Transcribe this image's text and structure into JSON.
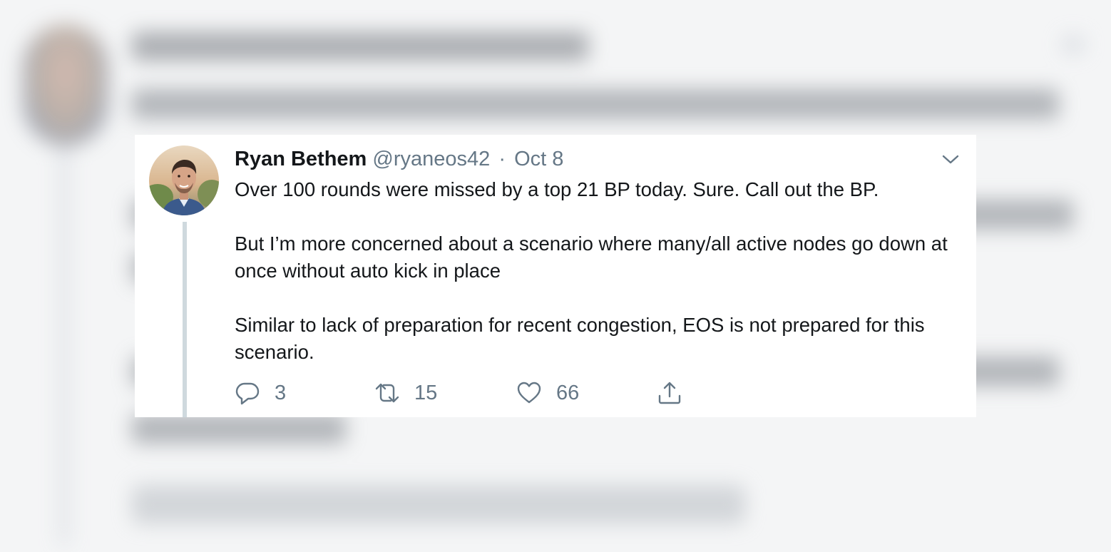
{
  "tweet": {
    "author_name": "Ryan Bethem",
    "handle": "@ryaneos42",
    "separator": "·",
    "date": "Oct 8",
    "paragraphs": [
      "Over 100 rounds were missed by a top 21 BP today. Sure. Call out the BP.",
      "But I’m more concerned about a scenario where many/all active nodes go down at once without auto kick in place",
      "Similar to lack of preparation for recent congestion, EOS is not prepared for this scenario."
    ],
    "actions": {
      "reply": {
        "icon": "reply-icon",
        "count": "3"
      },
      "retweet": {
        "icon": "retweet-icon",
        "count": "15"
      },
      "like": {
        "icon": "heart-icon",
        "count": "66"
      },
      "share": {
        "icon": "share-icon"
      }
    }
  },
  "colors": {
    "text_primary": "#14171a",
    "text_secondary": "#657786",
    "thread_line": "#cfd9de",
    "background": "#ffffff"
  }
}
